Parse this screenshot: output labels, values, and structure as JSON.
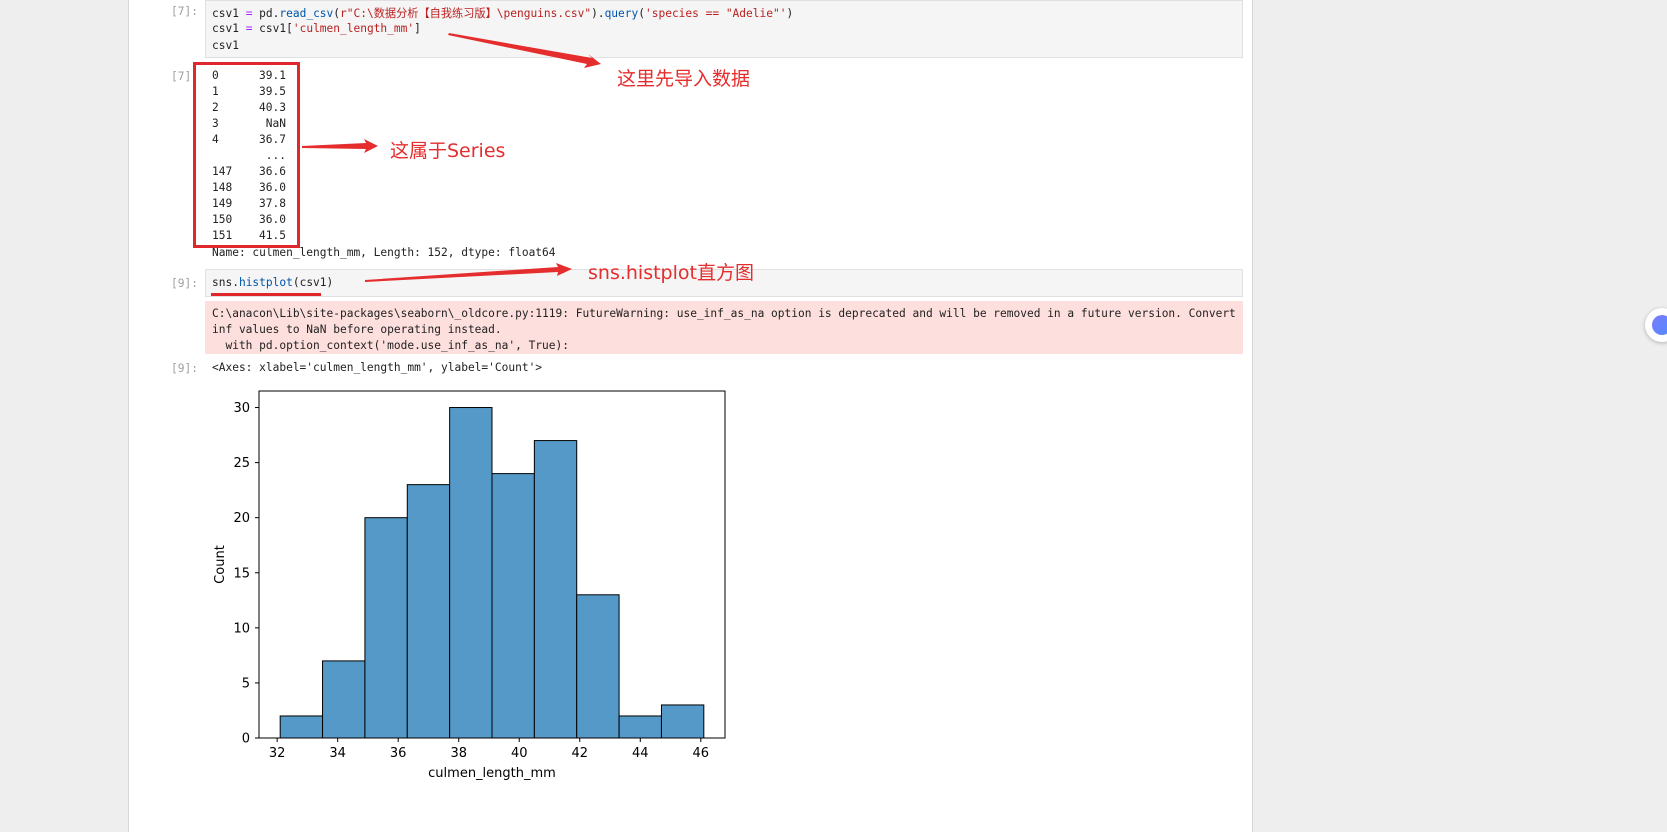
{
  "cell7": {
    "prompt_in": "[7]:",
    "code": [
      {
        "parts": [
          {
            "t": "csv1 ",
            "c": ""
          },
          {
            "t": "=",
            "c": "kw-op"
          },
          {
            "t": " pd.",
            "c": ""
          },
          {
            "t": "read_csv",
            "c": "fn"
          },
          {
            "t": "(",
            "c": ""
          },
          {
            "t": "r\"C:\\数据分析【自我练习版】\\penguins.csv\"",
            "c": "str"
          },
          {
            "t": ").",
            "c": ""
          },
          {
            "t": "query",
            "c": "fn"
          },
          {
            "t": "(",
            "c": ""
          },
          {
            "t": "'species == \"Adelie\"'",
            "c": "str"
          },
          {
            "t": ")",
            "c": ""
          }
        ]
      },
      {
        "parts": [
          {
            "t": "csv1 ",
            "c": ""
          },
          {
            "t": "=",
            "c": "kw-op"
          },
          {
            "t": " csv1[",
            "c": ""
          },
          {
            "t": "'culmen_length_mm'",
            "c": "str"
          },
          {
            "t": "]",
            "c": ""
          }
        ]
      },
      {
        "parts": [
          {
            "t": "csv1",
            "c": ""
          }
        ]
      }
    ],
    "prompt_out": "[7]:",
    "series_rows": [
      {
        "idx": "0",
        "val": "39.1"
      },
      {
        "idx": "1",
        "val": "39.5"
      },
      {
        "idx": "2",
        "val": "40.3"
      },
      {
        "idx": "3",
        "val": "NaN"
      },
      {
        "idx": "4",
        "val": "36.7"
      },
      {
        "idx": "",
        "val": "..."
      },
      {
        "idx": "147",
        "val": "36.6"
      },
      {
        "idx": "148",
        "val": "36.0"
      },
      {
        "idx": "149",
        "val": "37.8"
      },
      {
        "idx": "150",
        "val": "36.0"
      },
      {
        "idx": "151",
        "val": "41.5"
      }
    ],
    "series_footer": "Name: culmen_length_mm, Length: 152, dtype: float64"
  },
  "cell9": {
    "prompt_in": "[9]:",
    "code_prefix": "sns.",
    "code_fn": "histplot",
    "code_suffix": "(csv1)",
    "stderr": [
      "C:\\anacon\\Lib\\site-packages\\seaborn\\_oldcore.py:1119: FutureWarning: use_inf_as_na option is deprecated and will be removed in a future version. Convert",
      "inf values to NaN before operating instead.",
      "  with pd.option_context('mode.use_inf_as_na', True):"
    ],
    "prompt_out": "[9]:",
    "axes_repr": "<Axes: xlabel='culmen_length_mm', ylabel='Count'>"
  },
  "annotations": {
    "import_data": "这里先导入数据",
    "is_series": "这属于Series",
    "histplot": "sns.histplot直方图"
  },
  "colors": {
    "annotation_red": "#e52d2d",
    "bar_fill": "#5499c7",
    "stderr_bg": "#fddfdd"
  },
  "chart_data": {
    "type": "bar",
    "title": "",
    "xlabel": "culmen_length_mm",
    "ylabel": "Count",
    "bin_edges": [
      32.1,
      33.5,
      34.9,
      36.3,
      37.7,
      39.1,
      40.5,
      41.9,
      43.3,
      44.7,
      46.1
    ],
    "values": [
      2,
      7,
      20,
      23,
      30,
      24,
      27,
      13,
      2,
      3
    ],
    "xlim": [
      31.4,
      46.8
    ],
    "ylim": [
      0,
      31.5
    ],
    "xticks": [
      32,
      34,
      36,
      38,
      40,
      42,
      44,
      46
    ],
    "yticks": [
      0,
      5,
      10,
      15,
      20,
      25,
      30
    ],
    "grid": false
  }
}
